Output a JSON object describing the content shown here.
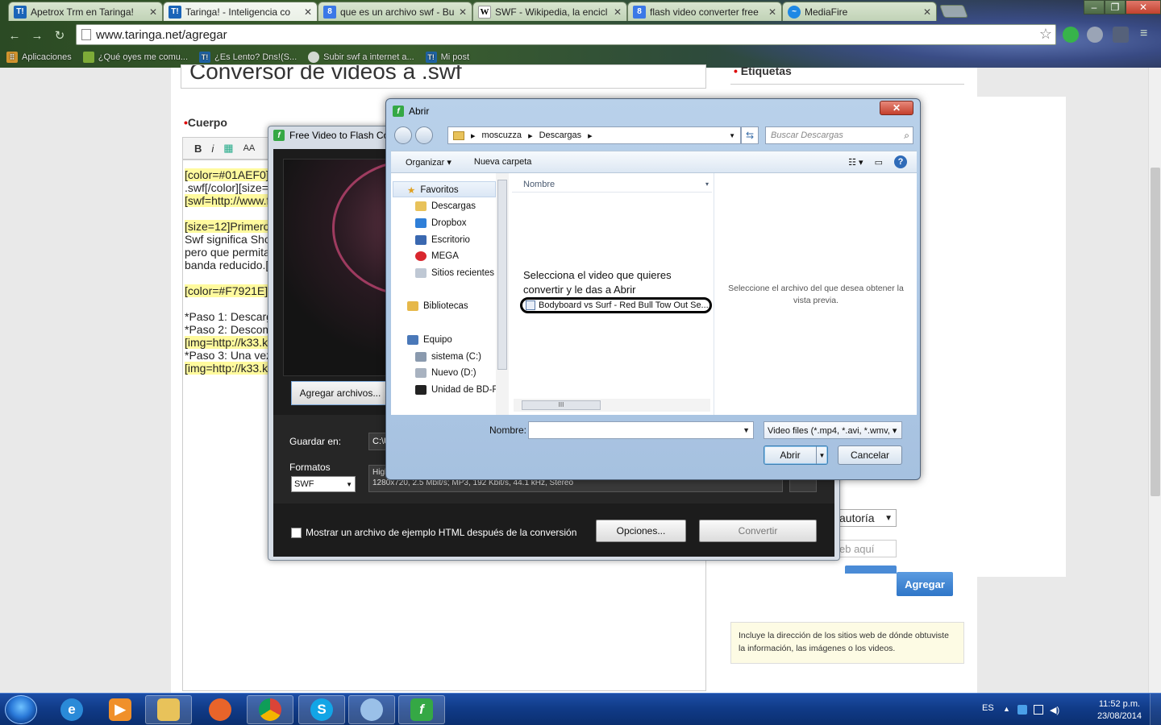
{
  "browser": {
    "tabs": [
      {
        "icon": "T!",
        "kind": "t",
        "label": "Apetrox Trm en Taringa!"
      },
      {
        "icon": "T!",
        "kind": "t",
        "label": "Taringa! - Inteligencia co"
      },
      {
        "icon": "8",
        "kind": "g",
        "label": "que es un archivo swf - Bu"
      },
      {
        "icon": "W",
        "kind": "w",
        "label": "SWF - Wikipedia, la encicl"
      },
      {
        "icon": "8",
        "kind": "g",
        "label": "flash video converter free"
      },
      {
        "icon": "~",
        "kind": "m",
        "label": "MediaFire"
      }
    ],
    "url": "www.taringa.net/agregar",
    "bookmarks": [
      {
        "label": "Aplicaciones"
      },
      {
        "label": "¿Qué oyes me comu..."
      },
      {
        "icon": "T!",
        "label": "¿Es Lento? Dns!(S..."
      },
      {
        "label": "Subir swf a internet a..."
      },
      {
        "icon": "T!",
        "label": "Mi post"
      }
    ]
  },
  "taringa": {
    "title_partial": "Conversor de videos a .swf",
    "cuerpo_label": "Cuerpo",
    "toolbar": {
      "bold": "B",
      "italic": "i",
      "font": "AA"
    },
    "editor_lines": [
      {
        "text": "[color=#01AEF0]",
        "hl": true
      },
      {
        "text": ".swf[/color][size=",
        "hl": false
      },
      {
        "text": "[swf=http://www.fi",
        "hl": true
      },
      {
        "text": "",
        "hl": false
      },
      {
        "text": "[size=12]Primero",
        "hl": true
      },
      {
        "text": "Swf significa  Sho",
        "hl": false
      },
      {
        "text": "pero que permita",
        "hl": false
      },
      {
        "text": "banda reducido.[",
        "hl": false
      },
      {
        "text": "",
        "hl": false
      },
      {
        "text": "[color=#F7921E]",
        "hl": true
      },
      {
        "text": "",
        "hl": false
      },
      {
        "text": "*Paso 1: Descarg",
        "hl": false
      },
      {
        "text": "*Paso 2: Descom",
        "hl": false
      },
      {
        "text": "[img=http://k33.k",
        "hl": true
      },
      {
        "text": "*Paso 3: Una vez",
        "hl": false
      },
      {
        "text": "[img=http://k33.k",
        "hl": true
      }
    ],
    "etiquetas_label": "Etiquetas",
    "autoria_value": "autoría",
    "web_placeholder": "eb aquí",
    "agregar_label": "Agregar",
    "info_text": "Incluye la dirección de los sitios web de dónde obtuviste la información, las imágenes o los videos."
  },
  "converter": {
    "window_title": "Free Video to Flash Converter",
    "add_files": "Agregar archivos...",
    "save_label": "Guardar en:",
    "save_path": "C:\\U",
    "formats_label": "Formatos",
    "format_value": "SWF",
    "format_desc_line1": "High",
    "format_desc_line2": "1280x720, 2.5 Mbit/s; MP3, 192 Kbit/s, 44.1 kHz, Stereo",
    "checkbox_label": "Mostrar un archivo de ejemplo HTML después de la conversión",
    "options_btn": "Opciones...",
    "convert_btn": "Convertir"
  },
  "dialog": {
    "title": "Abrir",
    "breadcrumb": [
      "moscuzza",
      "Descargas"
    ],
    "search_placeholder": "Buscar Descargas",
    "organize": "Organizar ▾",
    "new_folder": "Nueva carpeta",
    "nav": {
      "favorites": "Favoritos",
      "downloads": "Descargas",
      "dropbox": "Dropbox",
      "desktop": "Escritorio",
      "mega": "MEGA",
      "recent": "Sitios recientes",
      "libraries": "Bibliotecas",
      "computer": "Equipo",
      "drive_c": "sistema (C:)",
      "drive_d": "Nuevo (D:)",
      "drive_bd": "Unidad de BD-RE"
    },
    "column_name": "Nombre",
    "annotation": "Selecciona el video que quieres convertir y le das a Abrir",
    "file_name": "Bodyboard vs Surf - Red Bull Tow Out Se...",
    "preview_msg": "Seleccione el archivo del que desea obtener la vista previa.",
    "name_label": "Nombre:",
    "filter": "Video files (*.mp4, *.avi, *.wmv, ▾",
    "open_btn": "Abrir",
    "cancel_btn": "Cancelar"
  },
  "taskbar": {
    "lang": "ES",
    "time": "11:52 p.m.",
    "date": "23/08/2014"
  },
  "colors": {
    "accent": "#2f76c8",
    "highlight": "#fffa9e",
    "taskbar": "#103a86"
  }
}
